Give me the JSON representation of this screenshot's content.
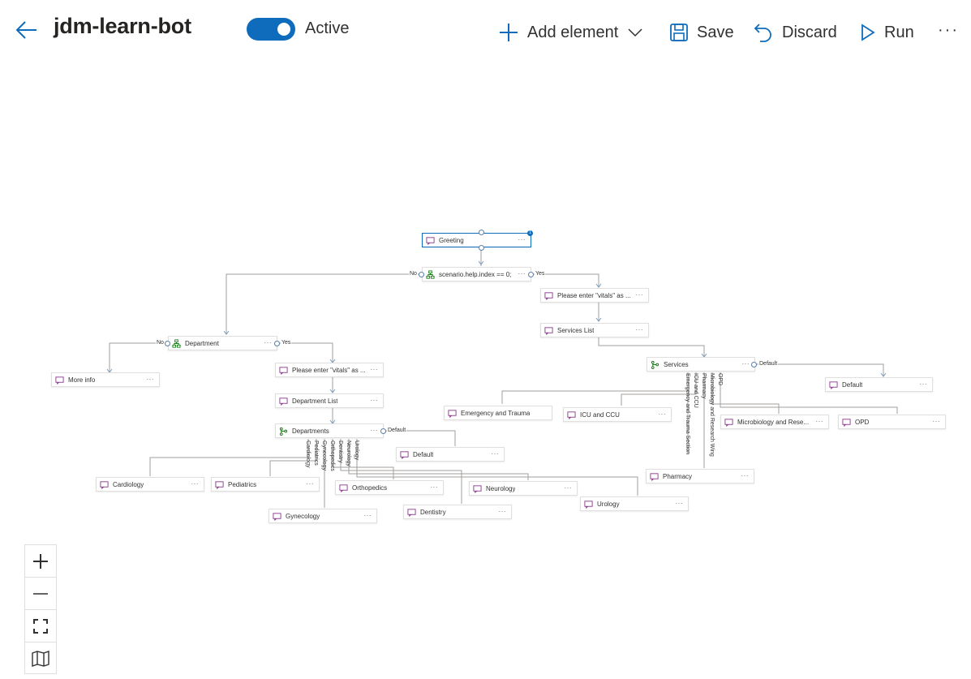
{
  "header": {
    "title": "jdm-learn-bot",
    "status_label": "Active",
    "add_element_label": "Add element",
    "save_label": "Save",
    "discard_label": "Discard",
    "run_label": "Run",
    "more_label": "···"
  },
  "canvas": {
    "nodes": {
      "greeting": "Greeting",
      "condition_main": "scenario.help.index == 0;",
      "please_enter_1": "Please enter \"vitals\" as ...",
      "services_list": "Services List",
      "services": "Services",
      "default_services": "Default",
      "emergency": "Emergency and Trauma",
      "icu": "ICU and CCU",
      "microbiology": "Microbiology and Rese...",
      "opd": "OPD",
      "pharmacy": "Pharmacy",
      "department": "Department",
      "more_info": "More info",
      "please_enter_2": "Please enter \"vitals\" as ...",
      "department_list": "Department List",
      "departments": "Departments",
      "default_departments": "Default",
      "cardiology": "Cardiology",
      "pediatrics": "Pediatrics",
      "orthopedics": "Orthopedics",
      "neurology": "Neurology",
      "urology": "Urology",
      "gynecology": "Gynecology",
      "dentistry": "Dentistry"
    },
    "edge_labels": {
      "no_main": "No",
      "yes_main": "Yes",
      "no_dept": "No",
      "yes_dept": "Yes",
      "default_services": "Default",
      "default_departments": "Default"
    },
    "branch_labels": {
      "services": [
        "Emergency and Trauma Section",
        "ICU and CCU",
        "Pharmacy",
        "Microbiology and Research Wing",
        "OPD"
      ],
      "departments": [
        "Cardiology",
        "Pediatrics",
        "Gynecology",
        "Orthopedics",
        "Dentistry",
        "Neurology",
        "Urology"
      ]
    },
    "badge_count": "1"
  },
  "zoom_controls": {
    "zoom_in": "zoom-in",
    "zoom_out": "zoom-out",
    "fit": "fit-to-screen",
    "minimap": "minimap"
  },
  "colors": {
    "accent": "#0f6cbd",
    "message_icon": "#8b3a8b",
    "condition_icon": "#107c10"
  }
}
